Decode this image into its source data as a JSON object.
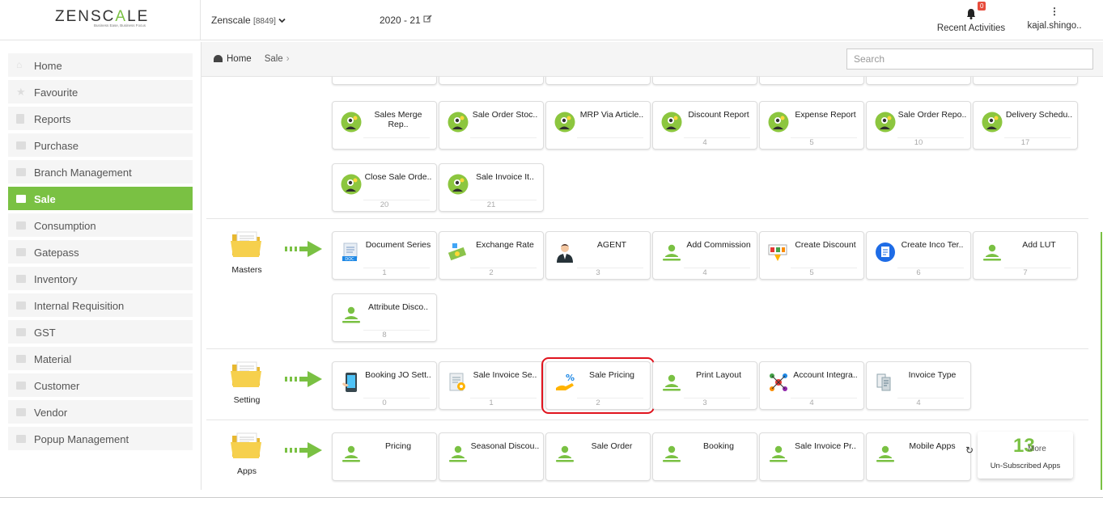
{
  "header": {
    "brand_part1": "ZENSC",
    "brand_part2": "A",
    "brand_part3": "LE",
    "tagline": "Business Ease, Business Focus",
    "company_name": "Zenscale",
    "company_code": "[8849]",
    "financial_year": "2020 - 21",
    "notification_count": "0",
    "recent_activities": "Recent Activities",
    "user_name": "kajal.shingo.."
  },
  "sidebar": {
    "items": [
      {
        "label": "Home",
        "icon": "home-icon"
      },
      {
        "label": "Favourite",
        "icon": "star-icon"
      },
      {
        "label": "Reports",
        "icon": "file-icon"
      },
      {
        "label": "Purchase",
        "icon": "folder-icon"
      },
      {
        "label": "Branch Management",
        "icon": "folder-icon"
      },
      {
        "label": "Sale",
        "icon": "folder-icon",
        "active": true
      },
      {
        "label": "Consumption",
        "icon": "folder-icon"
      },
      {
        "label": "Gatepass",
        "icon": "folder-icon"
      },
      {
        "label": "Inventory",
        "icon": "folder-icon"
      },
      {
        "label": "Internal Requisition",
        "icon": "folder-icon"
      },
      {
        "label": "GST",
        "icon": "folder-icon"
      },
      {
        "label": "Material",
        "icon": "folder-icon"
      },
      {
        "label": "Customer",
        "icon": "folder-icon"
      },
      {
        "label": "Vendor",
        "icon": "folder-icon"
      },
      {
        "label": "Popup Management",
        "icon": "folder-icon"
      }
    ]
  },
  "breadcrumb": {
    "home": "Home",
    "current": "Sale"
  },
  "search": {
    "placeholder": "Search"
  },
  "reports": {
    "cards": [
      {
        "title": "Sales Merge Rep..",
        "num": ""
      },
      {
        "title": "Sale Order Stoc..",
        "num": ""
      },
      {
        "title": "MRP Via Article..",
        "num": ""
      },
      {
        "title": "Discount Report",
        "num": "4"
      },
      {
        "title": "Expense Report",
        "num": "5"
      },
      {
        "title": "Sale Order Repo..",
        "num": "10"
      },
      {
        "title": "Delivery Schedu..",
        "num": "17"
      },
      {
        "title": "Close Sale Orde..",
        "num": "20"
      },
      {
        "title": "Sale Invoice It..",
        "num": "21"
      }
    ]
  },
  "masters": {
    "label": "Masters",
    "cards": [
      {
        "title": "Document Series",
        "num": "1"
      },
      {
        "title": "Exchange Rate",
        "num": "2"
      },
      {
        "title": "AGENT",
        "num": "3"
      },
      {
        "title": "Add Commission",
        "num": "4"
      },
      {
        "title": "Create Discount",
        "num": "5"
      },
      {
        "title": "Create Inco Ter..",
        "num": "6"
      },
      {
        "title": "Add LUT",
        "num": "7"
      },
      {
        "title": "Attribute Disco..",
        "num": "8"
      }
    ]
  },
  "setting": {
    "label": "Setting",
    "cards": [
      {
        "title": "Booking JO Sett..",
        "num": "0"
      },
      {
        "title": "Sale Invoice Se..",
        "num": "1"
      },
      {
        "title": "Sale Pricing",
        "num": "2"
      },
      {
        "title": "Print Layout",
        "num": "3"
      },
      {
        "title": "Account Integra..",
        "num": "4"
      },
      {
        "title": "Invoice Type",
        "num": "4"
      }
    ]
  },
  "apps": {
    "label": "Apps",
    "cards": [
      {
        "title": "Pricing"
      },
      {
        "title": "Seasonal Discou.."
      },
      {
        "title": "Sale Order"
      },
      {
        "title": "Booking"
      },
      {
        "title": "Sale Invoice Pr.."
      },
      {
        "title": "Mobile Apps"
      }
    ],
    "more_count": "13",
    "more_label": "More",
    "unsubscribed": "Un-Subscribed Apps"
  },
  "colors": {
    "accent": "#7ac143",
    "highlight": "#e0141e",
    "badge": "#e74c3c"
  }
}
